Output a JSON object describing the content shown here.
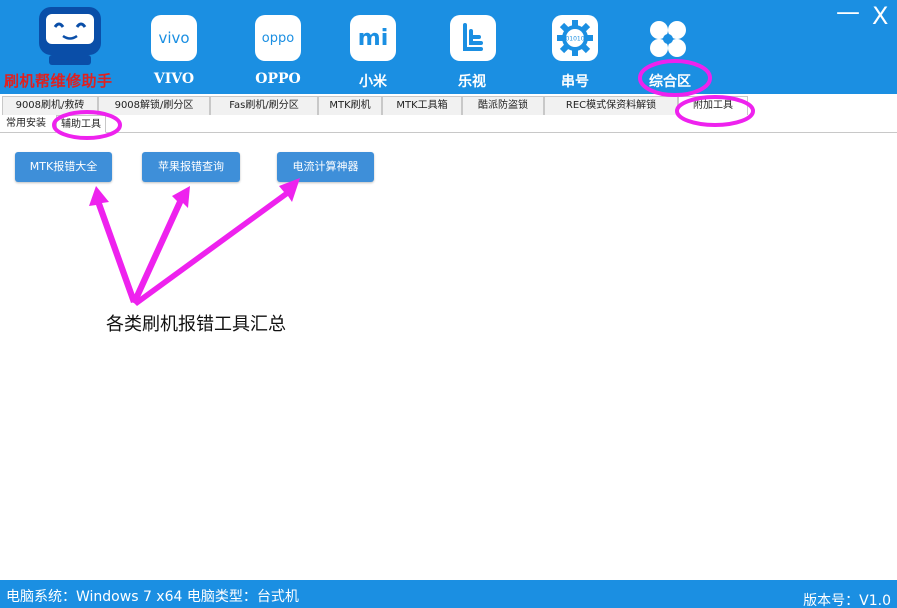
{
  "app": {
    "title": "刷机帮维修助手"
  },
  "nav": {
    "items": [
      {
        "label": "VIVO",
        "icon_text": "vivo"
      },
      {
        "label": "OPPO",
        "icon_text": "oppo"
      },
      {
        "label": "小米",
        "icon_text": "mi"
      },
      {
        "label": "乐视",
        "icon_text": ""
      },
      {
        "label": "串号",
        "icon_text": "01010"
      },
      {
        "label": "综合区",
        "icon_text": ""
      }
    ]
  },
  "window": {
    "minimize": "—",
    "close": "X"
  },
  "tabs_primary": [
    "9008刷机/救砖",
    "9008解锁/刷分区",
    "Fas刷机/刷分区",
    "MTK刷机",
    "MTK工具箱",
    "酷派防盗锁",
    "REC模式保资料解锁",
    "附加工具"
  ],
  "tabs_secondary": [
    "常用安装",
    "辅助工具"
  ],
  "tool_buttons": [
    "MTK报错大全",
    "苹果报错查询",
    "电流计算神器"
  ],
  "annotation": "各类刷机报错工具汇总",
  "status": {
    "left": "电脑系统：Windows 7 x64 电脑类型：台式机",
    "right": "版本号：V1.0"
  },
  "colors": {
    "header_bg": "#1b8fe2",
    "button_bg": "#3e8fd9",
    "highlight": "#ee22ee",
    "title_red": "#e0201f"
  }
}
